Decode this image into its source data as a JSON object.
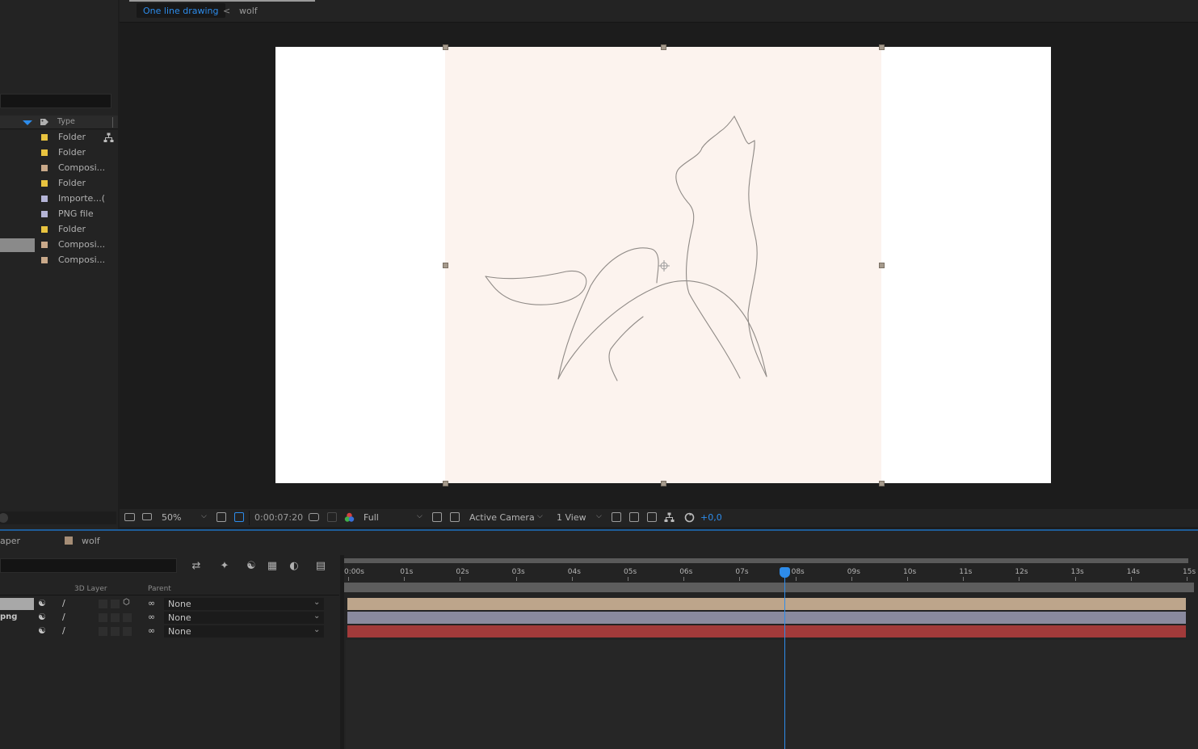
{
  "project": {
    "column_header": "Type",
    "items": [
      {
        "type": "Folder",
        "color": "#e8c33f"
      },
      {
        "type": "Folder",
        "color": "#e8c33f"
      },
      {
        "type": "Composi...",
        "color": "#c9a98a"
      },
      {
        "type": "Folder",
        "color": "#e8c33f"
      },
      {
        "type": "Importe...(",
        "color": "#b4b4d6"
      },
      {
        "type": "PNG file",
        "color": "#b4b4d6"
      },
      {
        "type": "Folder",
        "color": "#e8c33f"
      },
      {
        "type": "Composi...",
        "color": "#c9a98a",
        "selected": true
      },
      {
        "type": "Composi...",
        "color": "#c9a98a"
      }
    ]
  },
  "viewer": {
    "breadcrumb_active": "One line drawing",
    "breadcrumb_arrow": "<",
    "breadcrumb_next": "wolf",
    "toolbar": {
      "zoom": "50%",
      "timecode": "0:00:07:20",
      "resolution": "Full",
      "camera": "Active Camera",
      "views": "1 View",
      "exposure": "+0,0"
    }
  },
  "timeline": {
    "tab_partial": "aper",
    "tab_active": "wolf",
    "tab_color": "#a58d76",
    "col_3d": "3D Layer",
    "col_parent": "Parent",
    "ruler_labels": [
      "0:00s",
      "01s",
      "02s",
      "03s",
      "04s",
      "05s",
      "06s",
      "07s",
      "08s",
      "09s",
      "10s",
      "11s",
      "12s",
      "13s",
      "14s",
      "15s"
    ],
    "current_time_seconds": 7.8,
    "duration_seconds": 15,
    "layers": [
      {
        "name": "",
        "parent": "None",
        "bar_color": "#bda58b",
        "selected": true
      },
      {
        "name": "png",
        "parent": "None",
        "bar_color": "#8a8a9e"
      },
      {
        "name": "",
        "parent": "None",
        "bar_color": "#a23a3a"
      }
    ]
  }
}
